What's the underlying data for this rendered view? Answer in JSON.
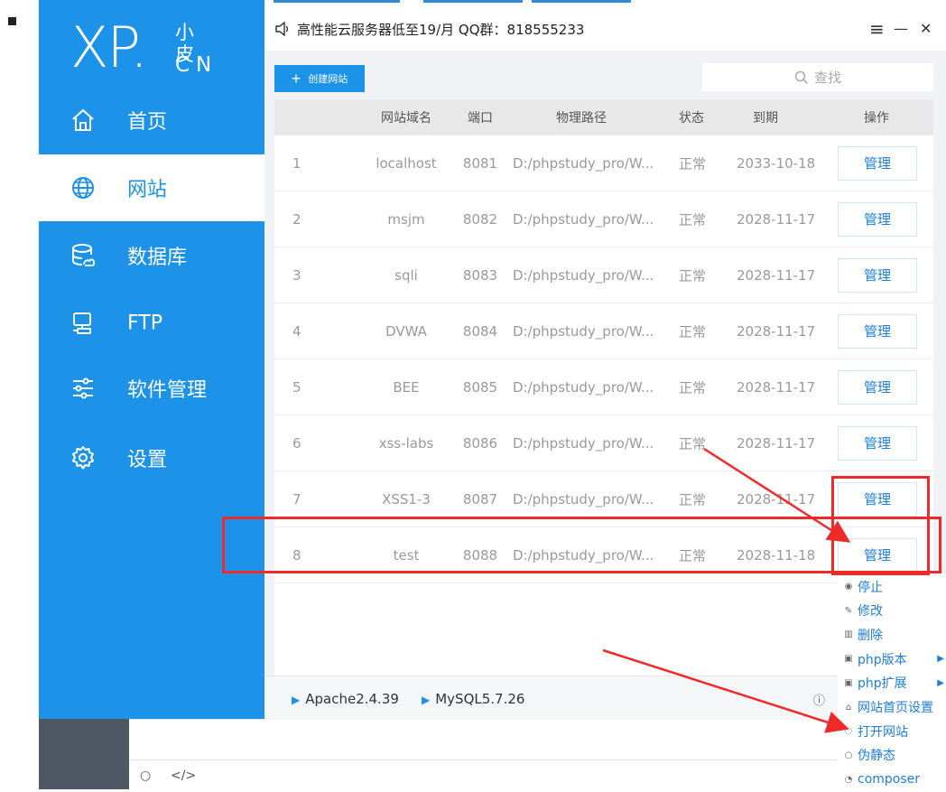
{
  "sidebar": {
    "logo": {
      "main": "XP",
      "dot": ".",
      "small": "小皮",
      "cn": "CN"
    },
    "items": [
      {
        "label": "首页",
        "icon": "home-icon"
      },
      {
        "label": "网站",
        "icon": "globe-icon",
        "active": true
      },
      {
        "label": "数据库",
        "icon": "database-icon"
      },
      {
        "label": "FTP",
        "icon": "ftp-server-icon"
      },
      {
        "label": "软件管理",
        "icon": "sliders-icon"
      },
      {
        "label": "设置",
        "icon": "gear-icon"
      }
    ]
  },
  "titlebar": {
    "notice": "高性能云服务器低至19/月 QQ群：818555233",
    "menu": "≡",
    "minimize": "—",
    "close": "✕"
  },
  "toolbar": {
    "create_label": "创建网站",
    "search_placeholder": "查找"
  },
  "table": {
    "columns": [
      "",
      "网站域名",
      "端口",
      "物理路径",
      "状态",
      "到期",
      "操作"
    ],
    "rows": [
      {
        "idx": "1",
        "domain": "localhost",
        "port": "8081",
        "path": "D:/phpstudy_pro/W...",
        "status": "正常",
        "expire": "2033-10-18",
        "action": "管理"
      },
      {
        "idx": "2",
        "domain": "msjm",
        "port": "8082",
        "path": "D:/phpstudy_pro/W...",
        "status": "正常",
        "expire": "2028-11-17",
        "action": "管理"
      },
      {
        "idx": "3",
        "domain": "sqli",
        "port": "8083",
        "path": "D:/phpstudy_pro/W...",
        "status": "正常",
        "expire": "2028-11-17",
        "action": "管理"
      },
      {
        "idx": "4",
        "domain": "DVWA",
        "port": "8084",
        "path": "D:/phpstudy_pro/W...",
        "status": "正常",
        "expire": "2028-11-17",
        "action": "管理"
      },
      {
        "idx": "5",
        "domain": "BEE",
        "port": "8085",
        "path": "D:/phpstudy_pro/W...",
        "status": "正常",
        "expire": "2028-11-17",
        "action": "管理"
      },
      {
        "idx": "6",
        "domain": "xss-labs",
        "port": "8086",
        "path": "D:/phpstudy_pro/W...",
        "status": "正常",
        "expire": "2028-11-17",
        "action": "管理"
      },
      {
        "idx": "7",
        "domain": "XSS1-3",
        "port": "8087",
        "path": "D:/phpstudy_pro/W...",
        "status": "正常",
        "expire": "2028-11-17",
        "action": "管理"
      },
      {
        "idx": "8",
        "domain": "test",
        "port": "8088",
        "path": "D:/phpstudy_pro/W...",
        "status": "正常",
        "expire": "2028-11-18",
        "action": "管理"
      }
    ]
  },
  "footer": {
    "services": [
      "Apache2.4.39",
      "MySQL5.7.26"
    ],
    "info_icon": "ⓘ"
  },
  "context_menu": {
    "items": [
      {
        "label": "停止",
        "icon": "stop-icon"
      },
      {
        "label": "修改",
        "icon": "edit-icon"
      },
      {
        "label": "删除",
        "icon": "trash-icon"
      },
      {
        "label": "php版本",
        "icon": "php-version-icon",
        "submenu": true
      },
      {
        "label": "php扩展",
        "icon": "php-extension-icon",
        "submenu": true
      },
      {
        "label": "网站首页设置",
        "icon": "home-settings-icon"
      },
      {
        "label": "打开网站",
        "icon": "open-site-icon"
      },
      {
        "label": "伪静态",
        "icon": "rewrite-icon"
      },
      {
        "label": "composer",
        "icon": "composer-icon"
      }
    ]
  },
  "colors": {
    "accent": "#1c92e8",
    "annotation": "#ee2a2a"
  }
}
